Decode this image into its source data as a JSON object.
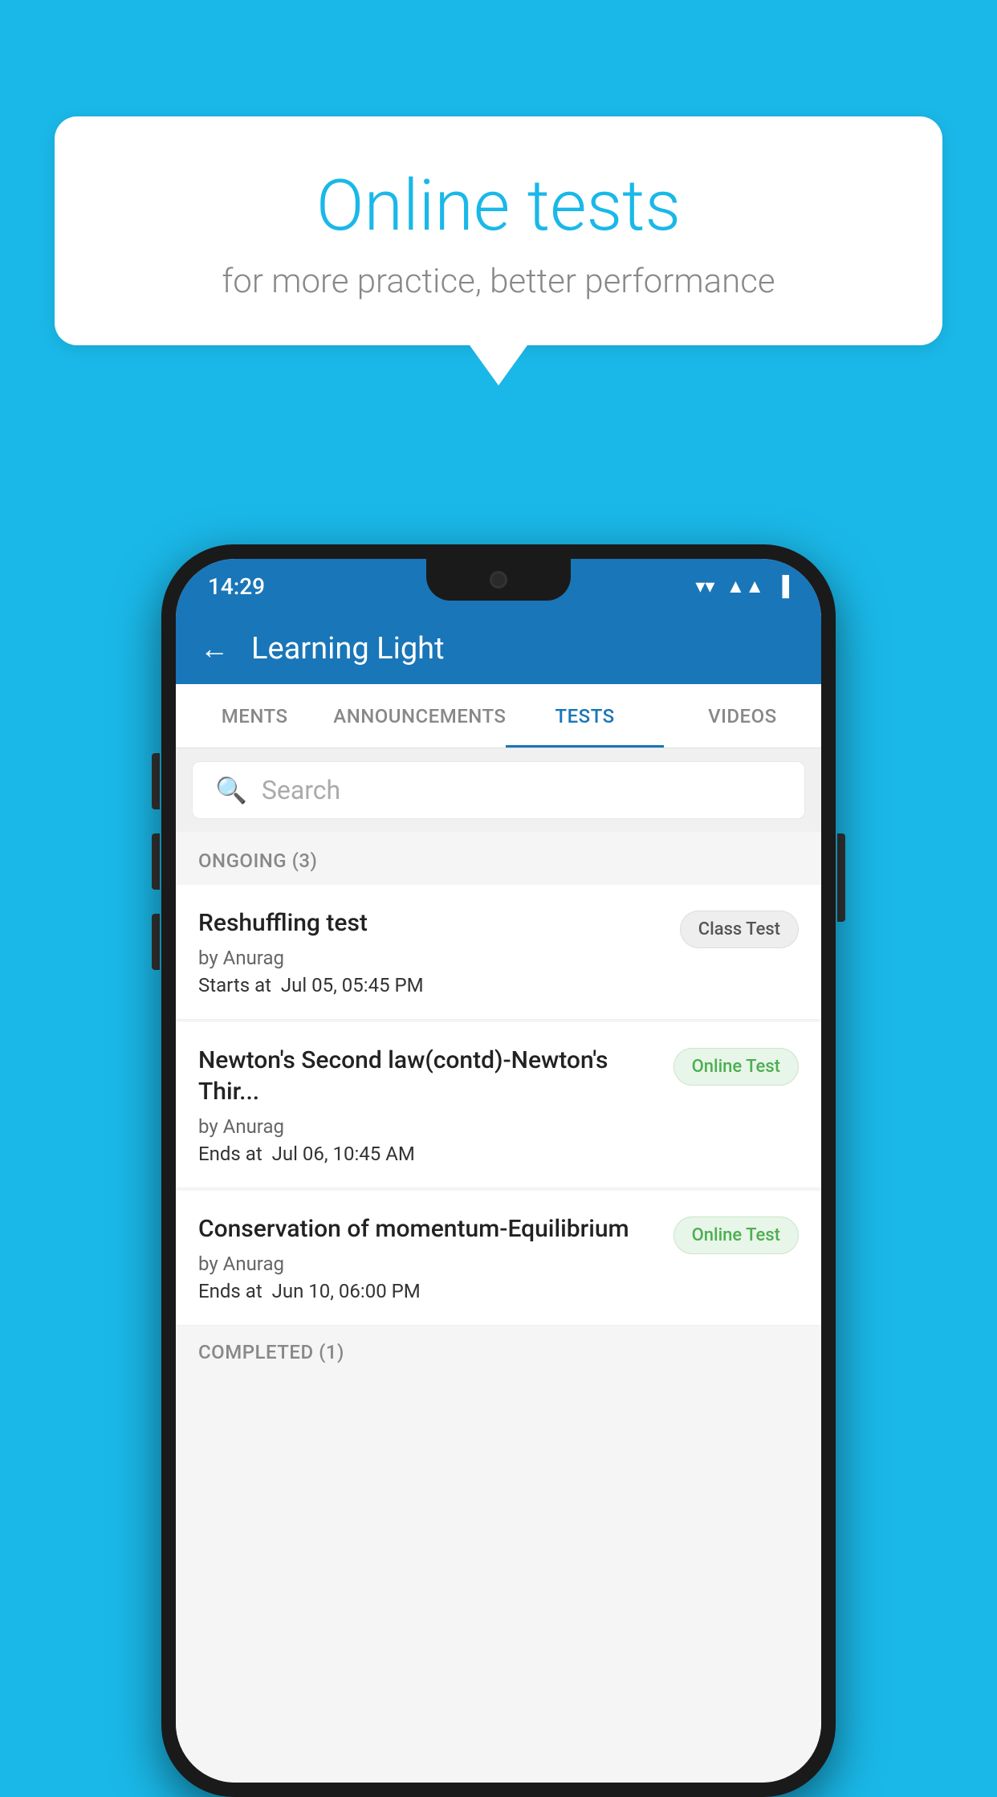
{
  "background_color": "#1ab8e8",
  "speech_bubble": {
    "title": "Online tests",
    "subtitle": "for more practice, better performance"
  },
  "phone": {
    "status_bar": {
      "time": "14:29",
      "icons": [
        "wifi",
        "signal",
        "battery"
      ]
    },
    "app_header": {
      "title": "Learning Light",
      "back_label": "←"
    },
    "tabs": [
      {
        "label": "MENTS",
        "active": false
      },
      {
        "label": "ANNOUNCEMENTS",
        "active": false
      },
      {
        "label": "TESTS",
        "active": true
      },
      {
        "label": "VIDEOS",
        "active": false
      }
    ],
    "search": {
      "placeholder": "Search"
    },
    "ongoing_section": {
      "title": "ONGOING (3)",
      "items": [
        {
          "title": "Reshuffling test",
          "author": "by Anurag",
          "date_label": "Starts at",
          "date": "Jul 05, 05:45 PM",
          "badge": "Class Test",
          "badge_type": "class"
        },
        {
          "title": "Newton's Second law(contd)-Newton's Thir...",
          "author": "by Anurag",
          "date_label": "Ends at",
          "date": "Jul 06, 10:45 AM",
          "badge": "Online Test",
          "badge_type": "online"
        },
        {
          "title": "Conservation of momentum-Equilibrium",
          "author": "by Anurag",
          "date_label": "Ends at",
          "date": "Jun 10, 06:00 PM",
          "badge": "Online Test",
          "badge_type": "online"
        }
      ]
    },
    "completed_section": {
      "title": "COMPLETED (1)"
    }
  }
}
